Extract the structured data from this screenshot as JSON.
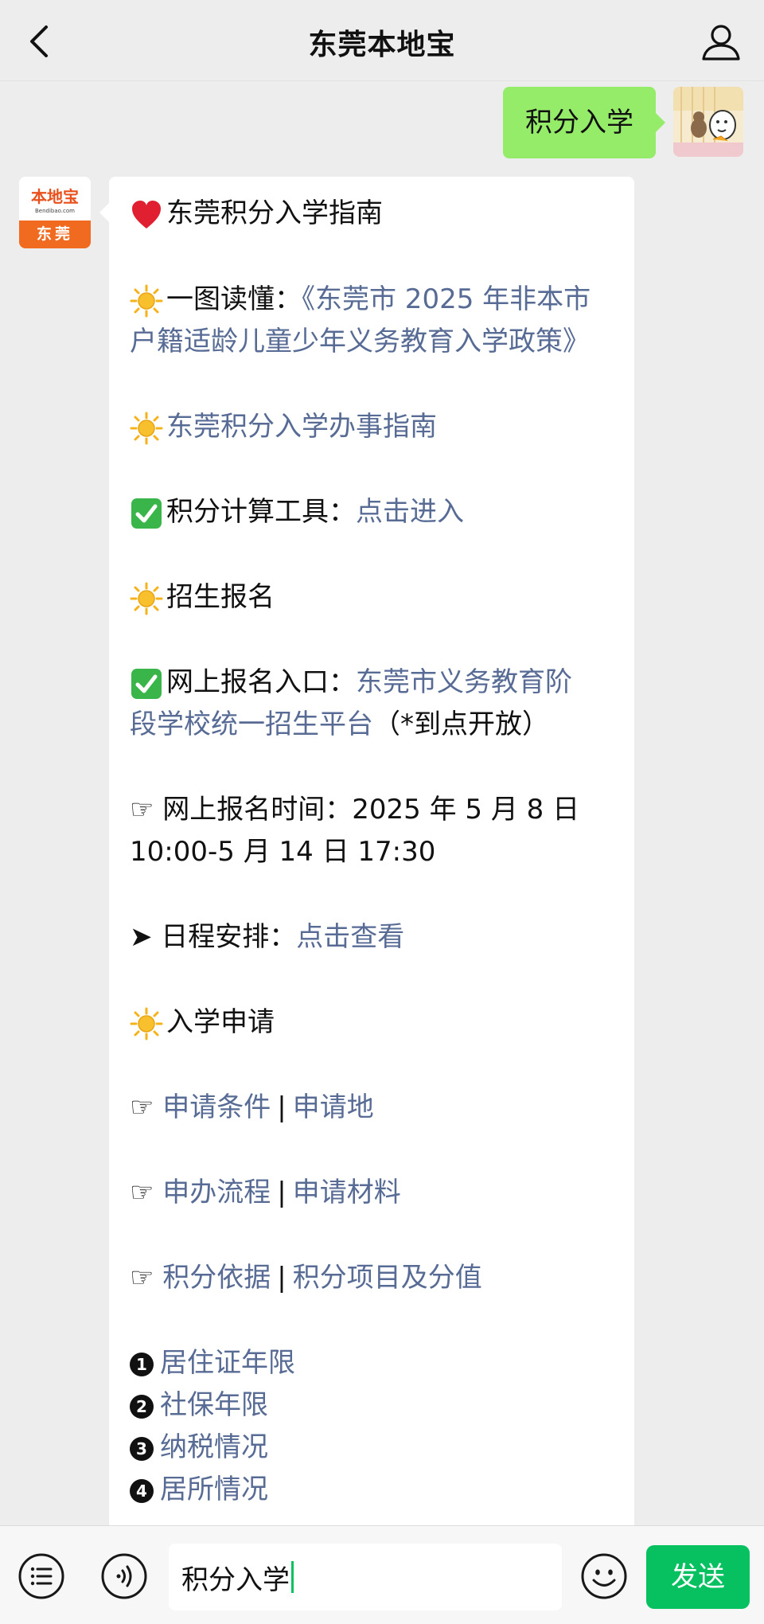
{
  "header": {
    "title": "东莞本地宝"
  },
  "outgoing": {
    "text": "积分入学"
  },
  "bot": {
    "avatar_logo": "本地宝",
    "avatar_domain": "Bendibao.com",
    "avatar_city": "东莞"
  },
  "message": {
    "heading": "东莞积分入学指南",
    "l2_prefix": "一图读懂：",
    "l2_link_a": "《东莞市 2025 年非本市",
    "l2_link_b": "户籍适龄儿童少年义务教育入学政策》",
    "l3_link": "东莞积分入学办事指南",
    "l4_prefix": "积分计算工具：",
    "l4_link": "点击进入",
    "l5_text": "招生报名",
    "l6_prefix": "网上报名入口：",
    "l6_link_a": "东莞市义务教育阶",
    "l6_link_b": "段学校统一招生平台",
    "l6_suffix": "（*到点开放）",
    "l7_a": "☞ 网上报名时间：2025 年 5 月 8 日",
    "l7_b": "10:00-5 月 14 日 17:30",
    "l8_prefix": "➤ 日程安排：",
    "l8_link": "点击查看",
    "l9_text": "入学申请",
    "l10_prefix": "☞ ",
    "l10_link_a": "申请条件",
    "l10_link_b": "申请地",
    "l11_prefix": "☞ ",
    "l11_link_a": "申办流程",
    "l11_link_b": "申请材料",
    "l12_prefix": "☞ ",
    "l12_link_a": "积分依据",
    "l12_link_b": "积分项目及分值",
    "sep": "|",
    "numbered": [
      {
        "n": "1",
        "label": "居住证年限"
      },
      {
        "n": "2",
        "label": "社保年限"
      },
      {
        "n": "3",
        "label": "纳税情况"
      },
      {
        "n": "4",
        "label": "居所情况"
      }
    ]
  },
  "input_bar": {
    "value": "积分入学",
    "send_label": "发送"
  },
  "colors": {
    "accent_green": "#07c160",
    "bubble_green": "#95ec69",
    "link": "#576b95",
    "heart": "#e02030",
    "sun": "#f5b21a",
    "check": "#3ab54a"
  }
}
